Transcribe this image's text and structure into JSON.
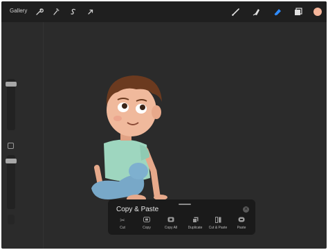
{
  "topbar": {
    "gallery_label": "Gallery",
    "left_tools": [
      "wrench-icon",
      "magic-wand-icon",
      "selection-s-icon",
      "transform-arrow-icon"
    ],
    "right_tools": [
      "brush-icon",
      "smudge-icon",
      "eraser-icon",
      "layers-icon",
      "color-swatch"
    ],
    "accent_color": "#2f8cff",
    "swatch_color": "#f5b59a"
  },
  "popover": {
    "title": "Copy & Paste",
    "actions": [
      {
        "label": "Cut",
        "icon": "scissors-icon"
      },
      {
        "label": "Copy",
        "icon": "copy-icon"
      },
      {
        "label": "Copy All",
        "icon": "copy-all-icon"
      },
      {
        "label": "Duplicate",
        "icon": "duplicate-icon"
      },
      {
        "label": "Cut & Paste",
        "icon": "cut-paste-icon"
      },
      {
        "label": "Paste",
        "icon": "paste-icon"
      }
    ]
  },
  "sidebar": {
    "brush_size_level": 0.92,
    "opacity_level": 0.92
  }
}
